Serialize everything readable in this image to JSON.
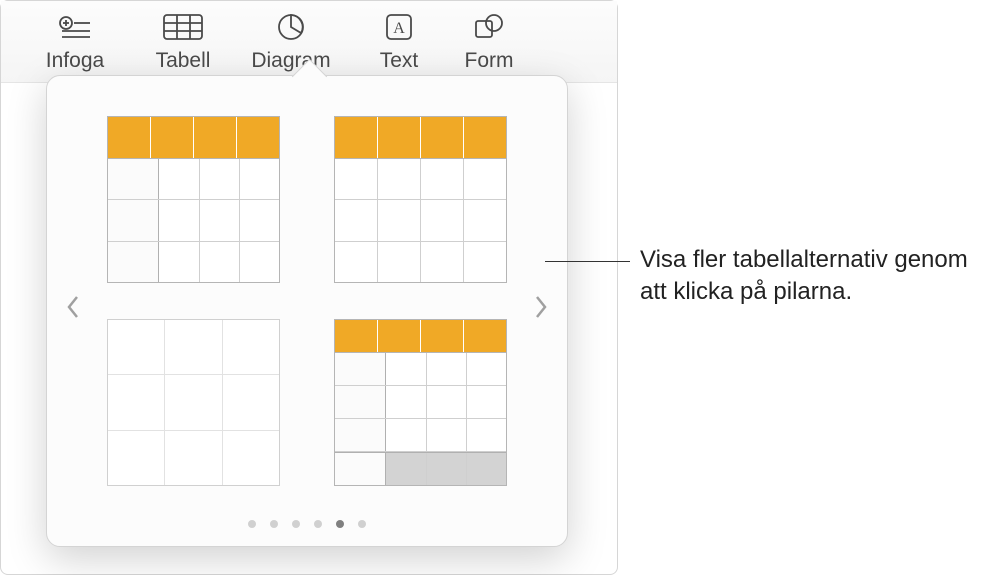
{
  "toolbar": {
    "insert": "Infoga",
    "table": "Tabell",
    "chart": "Diagram",
    "text": "Text",
    "shape": "Form"
  },
  "popover": {
    "nav_prev": "‹",
    "nav_next": "›",
    "page_count": 6,
    "active_page": 5
  },
  "callout": {
    "text": "Visa fler tabellalternativ genom att klicka på pilarna."
  },
  "colors": {
    "accent": "#f0a926"
  }
}
